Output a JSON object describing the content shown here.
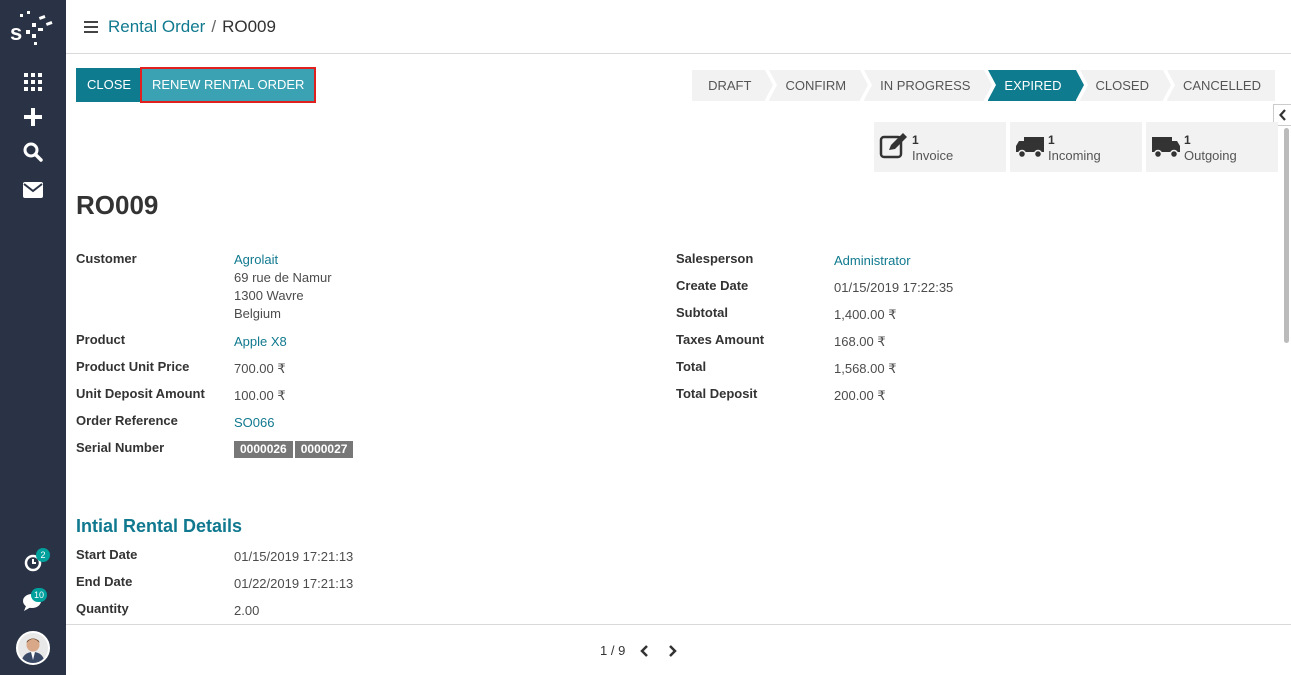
{
  "sidebar": {
    "badges": {
      "activity": "2",
      "discuss": "10"
    },
    "icons": [
      "apps-icon",
      "plus-icon",
      "search-icon",
      "mail-icon",
      "clock-icon",
      "chat-icon"
    ]
  },
  "breadcrumb": {
    "parent": "Rental Order",
    "separator": "/",
    "current": "RO009"
  },
  "buttons": {
    "close": "CLOSE",
    "renew": "RENEW RENTAL ORDER"
  },
  "stages": [
    {
      "label": "DRAFT",
      "active": false
    },
    {
      "label": "CONFIRM",
      "active": false
    },
    {
      "label": "IN PROGRESS",
      "active": false
    },
    {
      "label": "EXPIRED",
      "active": true
    },
    {
      "label": "CLOSED",
      "active": false
    },
    {
      "label": "CANCELLED",
      "active": false
    }
  ],
  "smart_buttons": [
    {
      "count": "1",
      "label": "Invoice",
      "icon": "edit-icon"
    },
    {
      "count": "1",
      "label": "Incoming",
      "icon": "truck-icon"
    },
    {
      "count": "1",
      "label": "Outgoing",
      "icon": "truck-icon"
    }
  ],
  "record": {
    "name": "RO009",
    "left": {
      "customer_label": "Customer",
      "customer_name": "Agrolait",
      "customer_addr1": "69 rue de Namur",
      "customer_addr2": "1300 Wavre",
      "customer_addr3": "Belgium",
      "product_label": "Product",
      "product": "Apple X8",
      "unit_price_label": "Product Unit Price",
      "unit_price": "700.00 ₹",
      "deposit_label": "Unit Deposit Amount",
      "deposit": "100.00 ₹",
      "order_ref_label": "Order Reference",
      "order_ref": "SO066",
      "serial_label": "Serial Number",
      "serials": [
        "0000026",
        "0000027"
      ]
    },
    "right": {
      "salesperson_label": "Salesperson",
      "salesperson": "Administrator",
      "create_date_label": "Create Date",
      "create_date": "01/15/2019 17:22:35",
      "subtotal_label": "Subtotal",
      "subtotal": "1,400.00 ₹",
      "taxes_label": "Taxes Amount",
      "taxes": "168.00 ₹",
      "total_label": "Total",
      "total": "1,568.00 ₹",
      "total_deposit_label": "Total Deposit",
      "total_deposit": "200.00 ₹"
    },
    "rental_section": {
      "title": "Intial Rental Details",
      "start_label": "Start Date",
      "start": "01/15/2019 17:21:13",
      "end_label": "End Date",
      "end": "01/22/2019 17:21:13",
      "qty_label": "Quantity",
      "qty": "2.00"
    }
  },
  "pager": {
    "text": "1 / 9"
  },
  "colors": {
    "sidebar": "#2a3345",
    "accent": "#0f7b8e",
    "link": "#10798f",
    "highlight": "#e0201f"
  }
}
